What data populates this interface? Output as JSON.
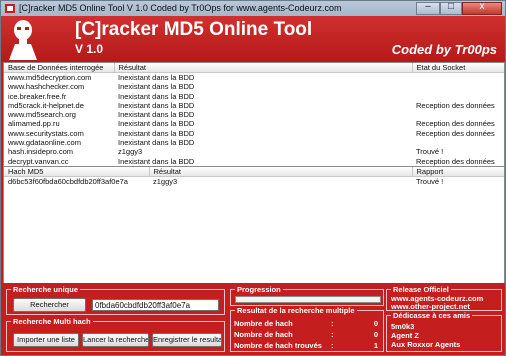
{
  "window": {
    "title": "[C]racker MD5 Online Tool V 1.0      Coded by Tr0Ops for www.agents-Codeurz.com",
    "close_glyph": "x"
  },
  "header": {
    "title": "[C]racker MD5 Online Tool",
    "version": "V 1.0",
    "coded_by": "Coded by Tr00ps"
  },
  "db_table": {
    "columns": [
      "Base de Données interrogée",
      "Résultat",
      "Etat du Socket"
    ],
    "rows": [
      {
        "db": "www.md5decryption.com",
        "result": "Inexistant dans la BDD",
        "state": ""
      },
      {
        "db": "www.hashchecker.com",
        "result": "Inexistant dans la BDD",
        "state": ""
      },
      {
        "db": "ice.breaker.free.fr",
        "result": "Inexistant dans la BDD",
        "state": ""
      },
      {
        "db": "md5crack.it-helpnet.de",
        "result": "Inexistant dans la BDD",
        "state": "Reception des données"
      },
      {
        "db": "www.md5search.org",
        "result": "Inexistant dans la BDD",
        "state": ""
      },
      {
        "db": "alimamed.pp.ru",
        "result": "Inexistant dans la BDD",
        "state": "Reception des données"
      },
      {
        "db": "www.securitystats.com",
        "result": "Inexistant dans la BDD",
        "state": "Reception des données"
      },
      {
        "db": "www.gdataonline.com",
        "result": "Inexistant dans la BDD",
        "state": ""
      },
      {
        "db": "hash.insidepro.com",
        "result": "z1ggy3",
        "state": "Trouvé !"
      },
      {
        "db": "decrypt.vanvan.cc",
        "result": "Inexistant dans la BDD",
        "state": "Reception des données"
      }
    ]
  },
  "hash_table": {
    "columns": [
      "Hach MD5",
      "Résultat",
      "Rapport"
    ],
    "rows": [
      {
        "hash": "d6bc53f60fbda60cbdfdb20ff3af0e7a",
        "result": "z1ggy3",
        "report": "Trouvé !"
      }
    ]
  },
  "single_search": {
    "title": "Recherche unique",
    "button": "Rechercher",
    "input_value": "0fbda60cbdfdb20ff3af0e7a"
  },
  "multi_search": {
    "title": "Recherche Multi hach",
    "import_button": "Importer une liste",
    "launch_button": "Lancer la recherche",
    "save_button": "Enregistrer le resultat"
  },
  "progression": {
    "title": "Progression",
    "fraction": 0
  },
  "multi_results": {
    "title": "Resultat de la recherche multiple",
    "stats": [
      {
        "label": "Nombre de hach",
        "value": "0"
      },
      {
        "label": "Nombre de hach",
        "value": "0"
      },
      {
        "label": "Nombre de hach trouvés",
        "value": "1"
      }
    ],
    "colon": ":"
  },
  "release": {
    "title": "Release Officiel",
    "lines": [
      "www.agents-codeurz.com",
      "www.other-project.net"
    ]
  },
  "dedication": {
    "title": "Dédicasse à ces amis",
    "names": [
      "5m0k3",
      "Agent Z",
      "Aux Roxxor Agents"
    ]
  },
  "colors": {
    "brand_red": "#c41e1e",
    "header_red": "#d03030"
  }
}
